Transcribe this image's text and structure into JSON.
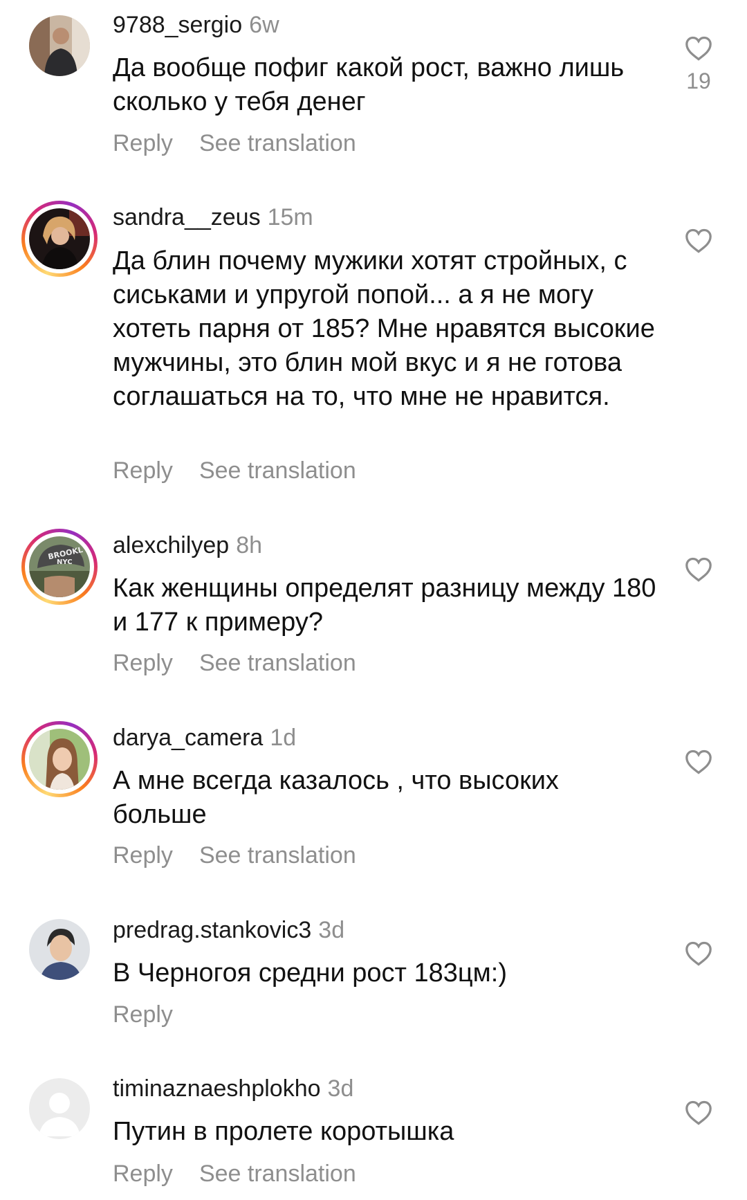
{
  "comments": [
    {
      "username": "9788_sergio",
      "time": "6w",
      "text": "Да вообще пофиг какой рост, важно лишь сколько у тебя денег",
      "likes": "19",
      "reply_label": "Reply",
      "translate_label": "See translation"
    },
    {
      "username": "sandra__zeus",
      "time": "15m",
      "text": "Да блин почему мужики хотят стройных, с сиськами и упругой попой... а я не могу хотеть парня от 185? Мне нравятся высокие мужчины, это блин мой вкус и я не готова соглашаться на то, что мне не нравится.",
      "reply_label": "Reply",
      "translate_label": "See translation"
    },
    {
      "username": "alexchilyep",
      "time": "8h",
      "text": "Как женщины определят разницу между 180 и 177 к примеру?",
      "reply_label": "Reply",
      "translate_label": "See translation",
      "avatar_cap_text_1": "BROOKL",
      "avatar_cap_text_2": "NYC"
    },
    {
      "username": "darya_camera",
      "time": "1d",
      "text": "А мне всегда казалось , что высоких больше",
      "reply_label": "Reply",
      "translate_label": "See translation"
    },
    {
      "username": "predrag.stankovic3",
      "time": "3d",
      "text": "В Черногоя средни рост 183цм:)",
      "reply_label": "Reply"
    },
    {
      "username": "timinaznaeshplokho",
      "time": "3d",
      "text": "Путин в пролете коротышка",
      "reply_label": "Reply",
      "translate_label": "See translation"
    }
  ],
  "icons": {
    "like": "heart-outline-icon"
  },
  "colors": {
    "text_primary": "#111111",
    "text_secondary": "#8e8e8e",
    "story_ring": [
      "#feda75",
      "#fa7e1e",
      "#d62976",
      "#962fbf"
    ]
  }
}
